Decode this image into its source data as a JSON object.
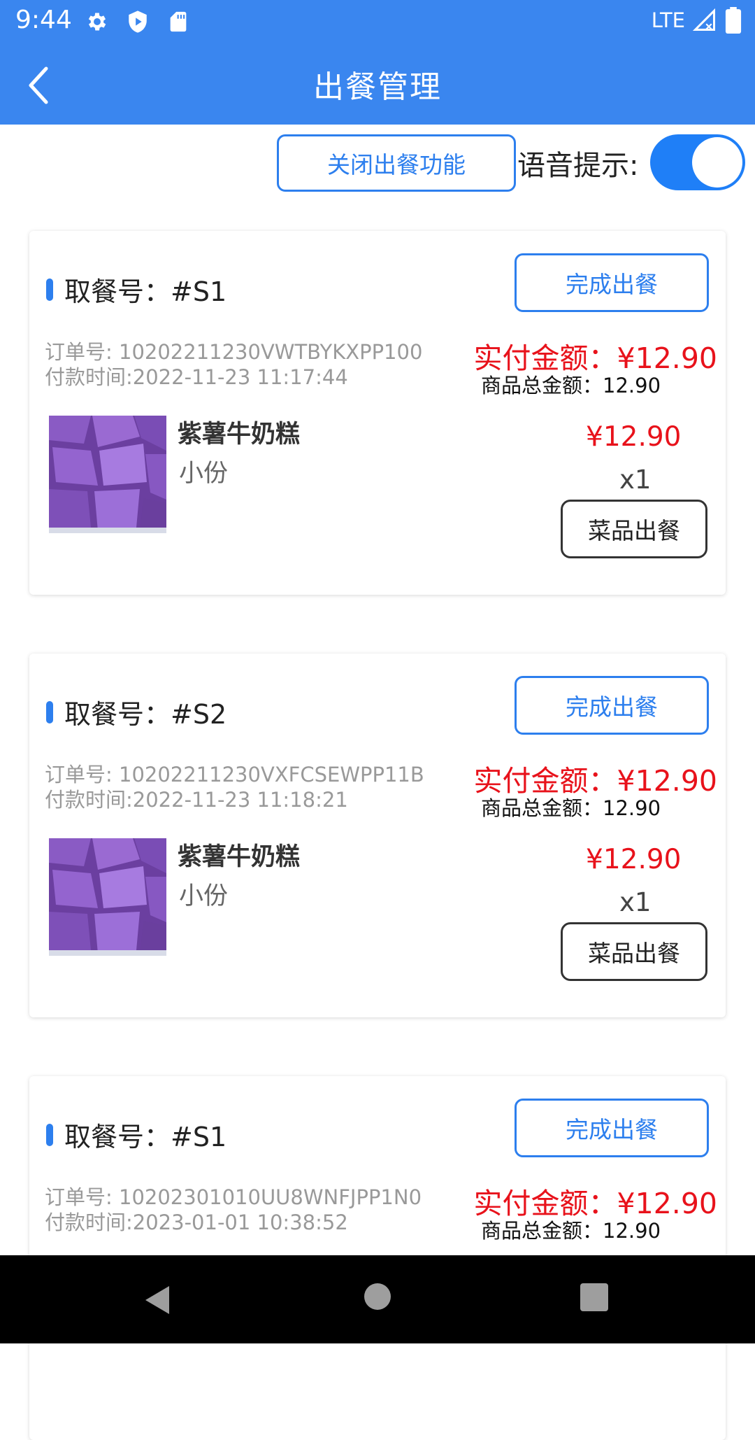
{
  "status_bar": {
    "time": "9:44",
    "network": "LTE",
    "icons": [
      "gear-icon",
      "shield-play-icon",
      "sd-card-icon",
      "signal-icon",
      "battery-icon"
    ]
  },
  "app_bar": {
    "title": "出餐管理",
    "back_icon": "back-arrow-icon"
  },
  "controls": {
    "close_button": "关闭出餐功能",
    "voice_label": "语音提示:",
    "voice_enabled": true
  },
  "orders": [
    {
      "pickup": "取餐号：#S1",
      "finish_button": "完成出餐",
      "order_no": "订单号: 10202211230VWTBYKXPP100",
      "pay_time": "付款时间:2022-11-23 11:17:44",
      "paid": "实付金额：¥12.90",
      "subtotal": "商品总金额：12.90",
      "item": {
        "name": "紫薯牛奶糕",
        "spec": "小份",
        "price": "¥12.90",
        "qty": "x1",
        "serve_button": "菜品出餐"
      }
    },
    {
      "pickup": "取餐号：#S2",
      "finish_button": "完成出餐",
      "order_no": "订单号: 10202211230VXFCSEWPP11B",
      "pay_time": "付款时间:2022-11-23 11:18:21",
      "paid": "实付金额：¥12.90",
      "subtotal": "商品总金额：12.90",
      "item": {
        "name": "紫薯牛奶糕",
        "spec": "小份",
        "price": "¥12.90",
        "qty": "x1",
        "serve_button": "菜品出餐"
      }
    },
    {
      "pickup": "取餐号：#S1",
      "finish_button": "完成出餐",
      "order_no": "订单号: 10202301010UU8WNFJPP1N0",
      "pay_time": "付款时间:2023-01-01 10:38:52",
      "paid": "实付金额：¥12.90",
      "subtotal": "商品总金额：12.90"
    }
  ],
  "colors": {
    "primary": "#3a86ef",
    "accent_blue": "#2d7fee",
    "price_red": "#e8121b",
    "toggle_on": "#1f7ff7"
  }
}
